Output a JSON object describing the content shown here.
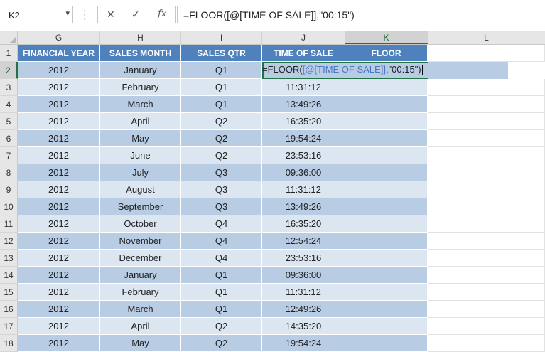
{
  "formula_bar": {
    "name_box": "K2",
    "name_box_arrow": "▾",
    "cancel_symbol": "✕",
    "enter_symbol": "✓",
    "fx_label": "fx",
    "formula": "=FLOOR([@[TIME OF SALE]],\"00:15\")"
  },
  "columns": [
    "G",
    "H",
    "I",
    "J",
    "K",
    "L"
  ],
  "header_row": [
    "FINANCIAL YEAR",
    "SALES MONTH",
    "SALES QTR",
    "TIME OF SALE",
    "FLOOR"
  ],
  "rows": [
    {
      "num": "1"
    },
    {
      "num": "2",
      "year": "2012",
      "month": "January",
      "qtr": "Q1",
      "time": ""
    },
    {
      "num": "3",
      "year": "2012",
      "month": "February",
      "qtr": "Q1",
      "time": "11:31:12"
    },
    {
      "num": "4",
      "year": "2012",
      "month": "March",
      "qtr": "Q1",
      "time": "13:49:26"
    },
    {
      "num": "5",
      "year": "2012",
      "month": "April",
      "qtr": "Q2",
      "time": "16:35:20"
    },
    {
      "num": "6",
      "year": "2012",
      "month": "May",
      "qtr": "Q2",
      "time": "19:54:24"
    },
    {
      "num": "7",
      "year": "2012",
      "month": "June",
      "qtr": "Q2",
      "time": "23:53:16"
    },
    {
      "num": "8",
      "year": "2012",
      "month": "July",
      "qtr": "Q3",
      "time": "09:36:00"
    },
    {
      "num": "9",
      "year": "2012",
      "month": "August",
      "qtr": "Q3",
      "time": "11:31:12"
    },
    {
      "num": "10",
      "year": "2012",
      "month": "September",
      "qtr": "Q3",
      "time": "13:49:26"
    },
    {
      "num": "11",
      "year": "2012",
      "month": "October",
      "qtr": "Q4",
      "time": "16:35:20"
    },
    {
      "num": "12",
      "year": "2012",
      "month": "November",
      "qtr": "Q4",
      "time": "12:54:24"
    },
    {
      "num": "13",
      "year": "2012",
      "month": "December",
      "qtr": "Q4",
      "time": "23:53:16"
    },
    {
      "num": "14",
      "year": "2012",
      "month": "January",
      "qtr": "Q1",
      "time": "09:36:00"
    },
    {
      "num": "15",
      "year": "2012",
      "month": "February",
      "qtr": "Q1",
      "time": "11:31:12"
    },
    {
      "num": "16",
      "year": "2012",
      "month": "March",
      "qtr": "Q1",
      "time": "12:49:26"
    },
    {
      "num": "17",
      "year": "2012",
      "month": "April",
      "qtr": "Q2",
      "time": "14:35:20"
    },
    {
      "num": "18",
      "year": "2012",
      "month": "May",
      "qtr": "Q2",
      "time": "19:54:24"
    }
  ],
  "edit": {
    "prefix": "=FLOOR(",
    "ref": "[@[TIME OF SALE]]",
    "suffix": ",\"00:15\")"
  },
  "colors": {
    "header_bg": "#4f81bd",
    "band_dark": "#b8cce4",
    "band_light": "#dce6f1",
    "ref_color": "#4a78c2",
    "active_border": "#217346"
  }
}
